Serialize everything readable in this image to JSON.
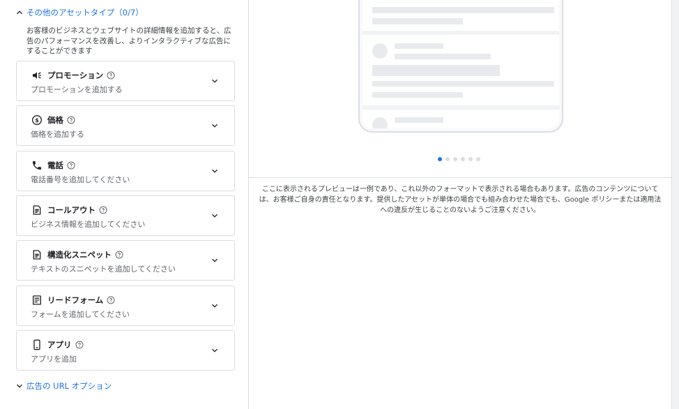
{
  "left": {
    "section_title": "その他のアセットタイプ（0/7）",
    "description": "お客様のビジネスとウェブサイトの詳細情報を追加すると、広告のパフォーマンスを改善し、よりインタラクティブな広告にすることができます",
    "cards": [
      {
        "title": "プロモーション",
        "subtitle": "プロモーションを追加する",
        "icon": "megaphone-icon"
      },
      {
        "title": "価格",
        "subtitle": "価格を追加する",
        "icon": "price-icon"
      },
      {
        "title": "電話",
        "subtitle": "電話番号を追加してください",
        "icon": "phone-icon"
      },
      {
        "title": "コールアウト",
        "subtitle": "ビジネス情報を追加してください",
        "icon": "document-icon"
      },
      {
        "title": "構造化スニペット",
        "subtitle": "テキストのスニペットを追加してください",
        "icon": "document-icon"
      },
      {
        "title": "リードフォーム",
        "subtitle": "フォームを追加してください",
        "icon": "form-icon"
      },
      {
        "title": "アプリ",
        "subtitle": "アプリを追加",
        "icon": "mobile-icon"
      }
    ],
    "url_option_title": "広告の URL オプション"
  },
  "right": {
    "carousel": {
      "count": 6,
      "active_index": 0
    },
    "notice": "ここに表示されるプレビューは一例であり、これ以外のフォーマットで表示される場合もあります。広告のコンテンツについては、お客様ご自身の責任となります。提供したアセットが単体の場合でも組み合わせた場合でも、Google ポリシーまたは適用法への違反が生じることのないようご注意ください。"
  },
  "colors": {
    "accent": "#1a73e8",
    "border": "#dadce0",
    "skeleton": "#e8eaed"
  }
}
